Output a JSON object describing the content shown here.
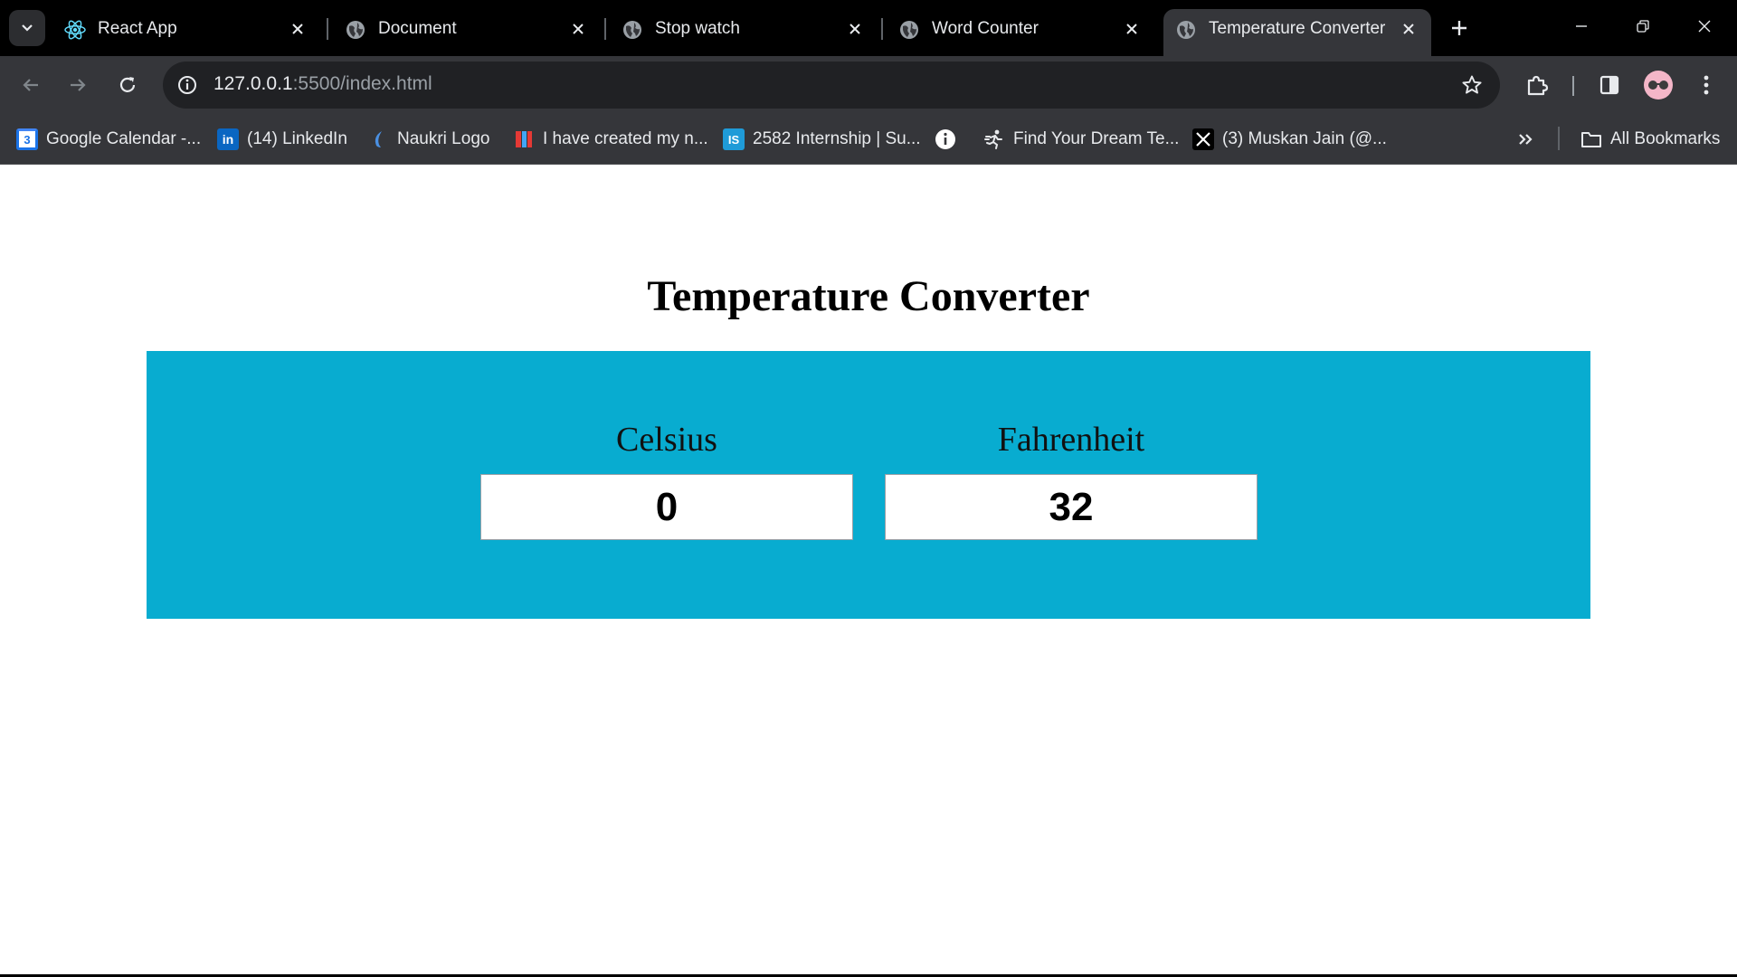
{
  "browser": {
    "tabs": [
      {
        "title": "React App",
        "icon": "react-icon",
        "active": false
      },
      {
        "title": "Document",
        "icon": "globe-icon",
        "active": false
      },
      {
        "title": "Stop watch",
        "icon": "globe-icon",
        "active": false
      },
      {
        "title": "Word Counter",
        "icon": "globe-icon",
        "active": false
      },
      {
        "title": "Temperature Converter",
        "icon": "globe-icon",
        "active": true
      }
    ],
    "url_host": "127.0.0.1",
    "url_path": ":5500/index.html",
    "bookmarks": [
      {
        "label": "Google Calendar -...",
        "icon": "google-calendar-icon"
      },
      {
        "label": "(14) LinkedIn",
        "icon": "linkedin-icon"
      },
      {
        "label": "Naukri Logo",
        "icon": "naukri-icon"
      },
      {
        "label": "I have created my n...",
        "icon": "bookmark-site-icon"
      },
      {
        "label": "2582 Internship | Su...",
        "icon": "internshala-icon"
      },
      {
        "label": "",
        "icon": "info-icon"
      },
      {
        "label": "Find Your Dream Te...",
        "icon": "runner-icon"
      },
      {
        "label": "(3) Muskan Jain (@...",
        "icon": "x-logo-icon"
      }
    ],
    "all_bookmarks_label": "All Bookmarks",
    "colors": {
      "tabstrip": "#000000",
      "toolbar": "#35363a",
      "omnibox": "#202124"
    }
  },
  "page": {
    "title": "Temperature Converter",
    "celsius": {
      "label": "Celsius",
      "value": "0"
    },
    "fahrenheit": {
      "label": "Fahrenheit",
      "value": "32"
    },
    "colors": {
      "panel": "#08acd0",
      "background": "#ffffff"
    }
  }
}
